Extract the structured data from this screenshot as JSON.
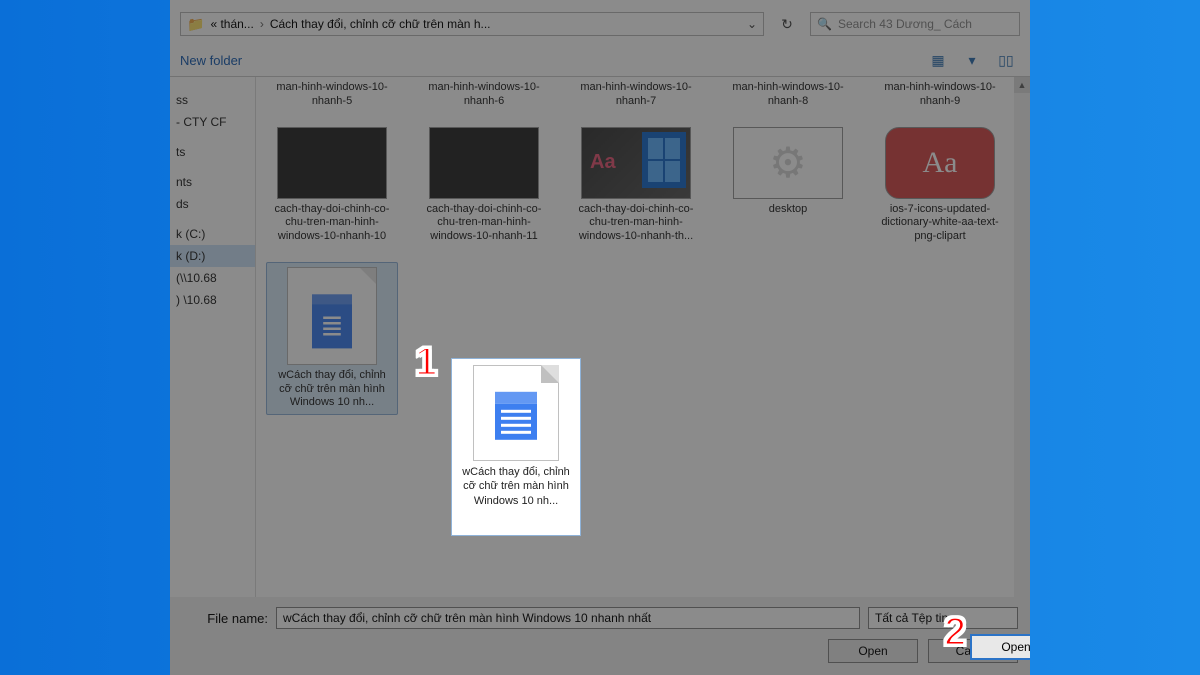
{
  "address": {
    "root_icon": "📁",
    "crumb1": "« thán...",
    "crumb2": "Cách thay đổi, chỉnh cỡ chữ trên màn h...",
    "dropdown_icon": "⌄",
    "refresh_icon": "↻"
  },
  "search": {
    "icon": "🔍",
    "placeholder": "Search 43 Dương_ Cách"
  },
  "toolbar": {
    "new_folder": "New folder",
    "view_icon": "▦",
    "view_dropdown": "▾",
    "preview_icon": "▯▯"
  },
  "sidebar": {
    "items": [
      "",
      "ss",
      "- CTY CF",
      "",
      "ts",
      "",
      "nts",
      "ds",
      "",
      "k (C:)",
      "k (D:)",
      "(\\\\10.68",
      ") \\10.68"
    ],
    "selected_index": 10
  },
  "files": {
    "row1": [
      {
        "name": "man-hinh-windows-10-nhanh-5"
      },
      {
        "name": "man-hinh-windows-10-nhanh-6"
      },
      {
        "name": "man-hinh-windows-10-nhanh-7"
      },
      {
        "name": "man-hinh-windows-10-nhanh-8"
      },
      {
        "name": "man-hinh-windows-10-nhanh-9"
      }
    ],
    "row2": [
      {
        "name": "cach-thay-doi-chinh-co-chu-tren-man-hinh-windows-10-nhanh-10",
        "thumb": "dark"
      },
      {
        "name": "cach-thay-doi-chinh-co-chu-tren-man-hinh-windows-10-nhanh-11",
        "thumb": "dark"
      },
      {
        "name": "cach-thay-doi-chinh-co-chu-tren-man-hinh-windows-10-nhanh-th...",
        "thumb": "aa"
      },
      {
        "name": "desktop",
        "thumb": "gear"
      },
      {
        "name": "ios-7-icons-updated-dictionary-white-aa-text-png-clipart",
        "thumb": "red"
      }
    ],
    "selected": {
      "name": "wCách thay đổi, chỉnh cỡ chữ trên màn hình Windows 10 nh..."
    }
  },
  "footer": {
    "filename_label": "File name:",
    "filename_value": "wCách thay đổi, chỉnh cỡ chữ trên màn hình Windows 10 nhanh nhất",
    "filetype": "Tất cả Tệp tin",
    "open": "Open",
    "cancel": "Cance"
  },
  "callouts": {
    "one": "1",
    "two": "2"
  }
}
